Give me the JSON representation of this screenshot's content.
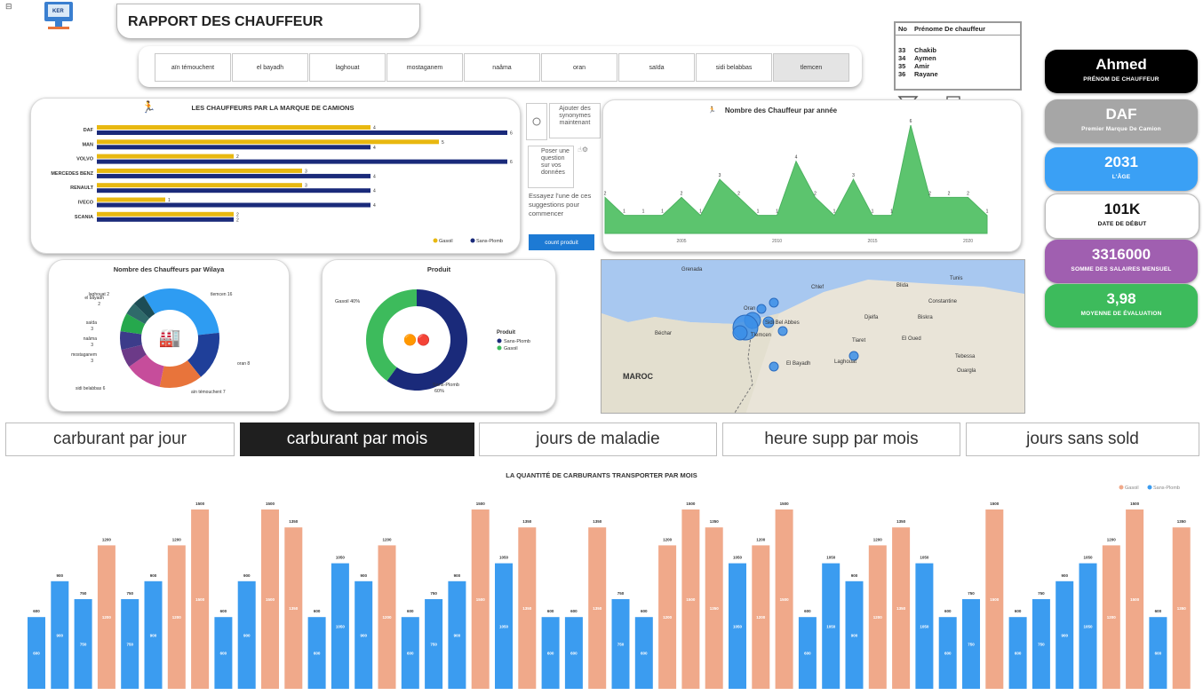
{
  "header": {
    "logo": "logo-computer",
    "title": "RAPPORT DES CHAUFFEUR"
  },
  "wilaya_slicer": [
    "aïn témouchent",
    "el bayadh",
    "laghouat",
    "mostaganem",
    "naâma",
    "oran",
    "saïda",
    "sidi belabbas",
    "tlemcen"
  ],
  "wilaya_selected": "tlemcen",
  "driver_table": {
    "headers": [
      "No",
      "Prénome De chauffeur"
    ],
    "rows": [
      [
        "33",
        "Chakib"
      ],
      [
        "34",
        "Aymen"
      ],
      [
        "35",
        "Amir"
      ],
      [
        "36",
        "Rayane"
      ]
    ]
  },
  "kpis": [
    {
      "value": "Ahmed",
      "label": "PRÉNOM DE CHAUFFEUR",
      "color": "#000000"
    },
    {
      "value": "DAF",
      "label": "Premier Marque De Camion",
      "color": "#a6a6a6"
    },
    {
      "value": "2031",
      "label": "L'ÂGE",
      "color": "#3aa0f5"
    },
    {
      "value": "101K",
      "label": "DATE DE DÉBUT",
      "color": "#ffffff"
    },
    {
      "value": "3316000",
      "label": "SOMME DES SALAIRES MENSUEL",
      "color": "#a05fb0"
    },
    {
      "value": "3,98",
      "label": "MOYENNE DE ÉVALUATION",
      "color": "#3dbb5c"
    }
  ],
  "qa": {
    "add_synonyms": "Ajouter des synonymes maintenant",
    "ask": "Poser une question sur vos données",
    "suggest": "Essayez l'une de ces suggestions pour commencer",
    "suggest_btn": "count produit"
  },
  "tabs": [
    {
      "label": "carburant par jour",
      "selected": false
    },
    {
      "label": "carburant par mois",
      "selected": true
    },
    {
      "label": "jours de maladie",
      "selected": false
    },
    {
      "label": "heure supp par mois",
      "selected": false
    },
    {
      "label": "jours sans sold",
      "selected": false
    }
  ],
  "map": {
    "labels": [
      "Oran",
      "Sidi Bel Abbes",
      "Tlemcen",
      "El Bayadh",
      "Laghouat",
      "MAROC",
      "Chlef",
      "Tiaret",
      "Blida",
      "Constantine",
      "Biskra",
      "Tebessa",
      "Djelfa",
      "Béchar",
      "Ouargla",
      "El Oued",
      "Tunis",
      "Grenada"
    ]
  },
  "chart_data": [
    {
      "type": "bar",
      "title": "LES CHAUFFEURS PAR LA MARQUE DE CAMIONS",
      "orientation": "horizontal",
      "categories": [
        "DAF",
        "MAN",
        "VOLVO",
        "MERCEDES BENZ",
        "RENAULT",
        "IVECO",
        "SCANIA"
      ],
      "series": [
        {
          "name": "Gasoil",
          "color": "#e8b810",
          "values": [
            4,
            5,
            2,
            3,
            3,
            1,
            2
          ]
        },
        {
          "name": "Sans-Plomb",
          "color": "#1a2a7a",
          "values": [
            6,
            4,
            6,
            4,
            4,
            4,
            2
          ]
        }
      ],
      "xlim": [
        0,
        6
      ],
      "legend": "bottom-right"
    },
    {
      "type": "area",
      "title": "Nombre des Chauffeur par année",
      "color": "#5cc46e",
      "x": [
        2001,
        2002,
        2003,
        2004,
        2005,
        2006,
        2007,
        2008,
        2009,
        2010,
        2011,
        2012,
        2013,
        2014,
        2015,
        2016,
        2017,
        2018,
        2019,
        2020,
        2021
      ],
      "values": [
        2,
        1,
        1,
        1,
        2,
        1,
        3,
        2,
        1,
        1,
        4,
        2,
        1,
        3,
        1,
        1,
        6,
        2,
        2,
        2,
        1
      ],
      "x_ticks": [
        "2005",
        "2010",
        "2015",
        "2020"
      ]
    },
    {
      "type": "pie",
      "title": "Nombre des Chauffeurs par Wilaya",
      "labels": [
        "tlemcen 16",
        "oran 8",
        "aïn témouchent 7",
        "sidi belabbas 6",
        "mostaganem 3",
        "naâma 3",
        "saïda 3",
        "el bayadh 2",
        "laghouat 2"
      ],
      "slices": [
        {
          "name": "tlemcen",
          "value": 16,
          "color": "#2e9cf2"
        },
        {
          "name": "oran",
          "value": 8,
          "color": "#1f3f99"
        },
        {
          "name": "aïn témouchent",
          "value": 7,
          "color": "#e8743b"
        },
        {
          "name": "sidi belabbas",
          "value": 6,
          "color": "#c64d9b"
        },
        {
          "name": "mostaganem",
          "value": 3,
          "color": "#6c3a88"
        },
        {
          "name": "naâma",
          "value": 3,
          "color": "#3c3c8a"
        },
        {
          "name": "saïda",
          "value": 3,
          "color": "#26a84d"
        },
        {
          "name": "el bayadh",
          "value": 2,
          "color": "#2f6a6a"
        },
        {
          "name": "laghouat",
          "value": 2,
          "color": "#1d4d55"
        }
      ]
    },
    {
      "type": "pie",
      "title": "Produit",
      "legend_title": "Produit",
      "labels": [
        "Gasoil 40%",
        "Sans-Plomb 60%"
      ],
      "slices": [
        {
          "name": "Sans-Plomb",
          "value": 60,
          "color": "#1a2a7a"
        },
        {
          "name": "Gasoil",
          "value": 40,
          "color": "#3dbb5c"
        }
      ]
    },
    {
      "type": "bar",
      "title": "LA QUANTITÉ DE CARBURANTS TRANSPORTER PAR MOIS",
      "legend": [
        "Gasoil",
        "Sans-Plomb"
      ],
      "legend_colors": {
        "Gasoil": "#f0a98a",
        "Sans-Plomb": "#3b9cf0"
      },
      "bars": [
        {
          "s": "Sans-Plomb",
          "v": 600
        },
        {
          "s": "Sans-Plomb",
          "v": 900
        },
        {
          "s": "Sans-Plomb",
          "v": 750
        },
        {
          "s": "Gasoil",
          "v": 1200
        },
        {
          "s": "Sans-Plomb",
          "v": 750
        },
        {
          "s": "Sans-Plomb",
          "v": 900
        },
        {
          "s": "Gasoil",
          "v": 1200
        },
        {
          "s": "Gasoil",
          "v": 1500
        },
        {
          "s": "Sans-Plomb",
          "v": 600
        },
        {
          "s": "Sans-Plomb",
          "v": 900
        },
        {
          "s": "Gasoil",
          "v": 1500
        },
        {
          "s": "Gasoil",
          "v": 1350
        },
        {
          "s": "Sans-Plomb",
          "v": 600
        },
        {
          "s": "Sans-Plomb",
          "v": 1050
        },
        {
          "s": "Sans-Plomb",
          "v": 900
        },
        {
          "s": "Gasoil",
          "v": 1200
        },
        {
          "s": "Sans-Plomb",
          "v": 600
        },
        {
          "s": "Sans-Plomb",
          "v": 750
        },
        {
          "s": "Sans-Plomb",
          "v": 900
        },
        {
          "s": "Gasoil",
          "v": 1500
        },
        {
          "s": "Sans-Plomb",
          "v": 1050
        },
        {
          "s": "Gasoil",
          "v": 1350
        },
        {
          "s": "Sans-Plomb",
          "v": 600
        },
        {
          "s": "Sans-Plomb",
          "v": 600
        },
        {
          "s": "Gasoil",
          "v": 1350
        },
        {
          "s": "Sans-Plomb",
          "v": 750
        },
        {
          "s": "Sans-Plomb",
          "v": 600
        },
        {
          "s": "Gasoil",
          "v": 1200
        },
        {
          "s": "Gasoil",
          "v": 1500
        },
        {
          "s": "Gasoil",
          "v": 1350
        },
        {
          "s": "Sans-Plomb",
          "v": 1050
        },
        {
          "s": "Gasoil",
          "v": 1200
        },
        {
          "s": "Gasoil",
          "v": 1500
        },
        {
          "s": "Sans-Plomb",
          "v": 600
        },
        {
          "s": "Sans-Plomb",
          "v": 1050
        },
        {
          "s": "Sans-Plomb",
          "v": 900
        },
        {
          "s": "Gasoil",
          "v": 1200
        },
        {
          "s": "Gasoil",
          "v": 1350
        },
        {
          "s": "Sans-Plomb",
          "v": 1050
        },
        {
          "s": "Sans-Plomb",
          "v": 600
        },
        {
          "s": "Sans-Plomb",
          "v": 750
        },
        {
          "s": "Gasoil",
          "v": 1500
        },
        {
          "s": "Sans-Plomb",
          "v": 600
        },
        {
          "s": "Sans-Plomb",
          "v": 750
        },
        {
          "s": "Sans-Plomb",
          "v": 900
        },
        {
          "s": "Sans-Plomb",
          "v": 1050
        },
        {
          "s": "Gasoil",
          "v": 1200
        },
        {
          "s": "Gasoil",
          "v": 1500
        },
        {
          "s": "Sans-Plomb",
          "v": 600
        },
        {
          "s": "Gasoil",
          "v": 1350
        }
      ],
      "ylim": [
        0,
        1500
      ]
    }
  ]
}
